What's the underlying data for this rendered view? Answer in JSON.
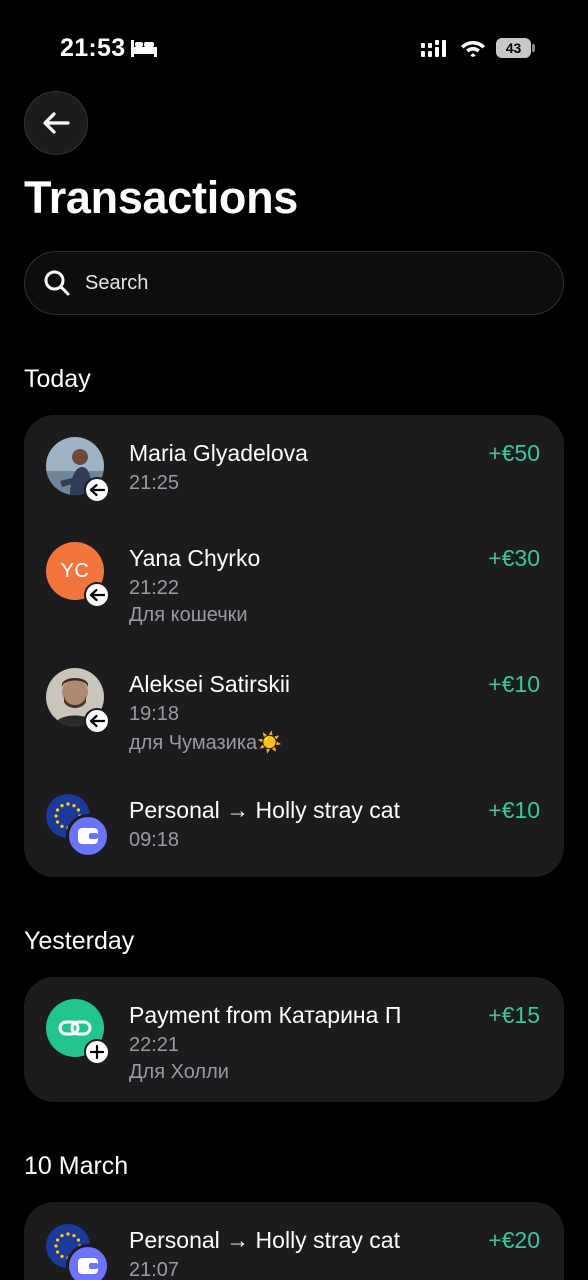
{
  "status_bar": {
    "time": "21:53",
    "battery": "43"
  },
  "header": {
    "title": "Transactions"
  },
  "search": {
    "placeholder": "Search"
  },
  "colors": {
    "amount": "#3fc49b",
    "card": "#1c1c1e",
    "orange": "#f0763e",
    "green": "#23c58e",
    "wallet": "#6b73ff"
  },
  "sections": [
    {
      "title": "Today",
      "items": [
        {
          "name": "Maria Glyadelova",
          "time": "21:25",
          "note": "",
          "amount": "+€50",
          "icon": "avatar-photo"
        },
        {
          "name": "Yana Chyrko",
          "time": "21:22",
          "note": "Для кошечки",
          "amount": "+€30",
          "icon": "initials-avatar",
          "initials": "YC"
        },
        {
          "name": "Aleksei Satirskii",
          "time": "19:18",
          "note": "для Чумазика☀️",
          "amount": "+€10",
          "icon": "avatar-photo"
        },
        {
          "name": "Personal → Holly stray cat",
          "time": "09:18",
          "note": "",
          "amount": "+€10",
          "icon": "eu-wallet"
        }
      ]
    },
    {
      "title": "Yesterday",
      "items": [
        {
          "name": "Payment from Катарина П",
          "time": "22:21",
          "note": "Для Холли",
          "amount": "+€15",
          "icon": "link-icon"
        }
      ]
    },
    {
      "title": "10 March",
      "items": [
        {
          "name": "Personal → Holly stray cat",
          "time": "21:07",
          "note": "",
          "amount": "+€20",
          "icon": "eu-wallet"
        }
      ]
    }
  ]
}
